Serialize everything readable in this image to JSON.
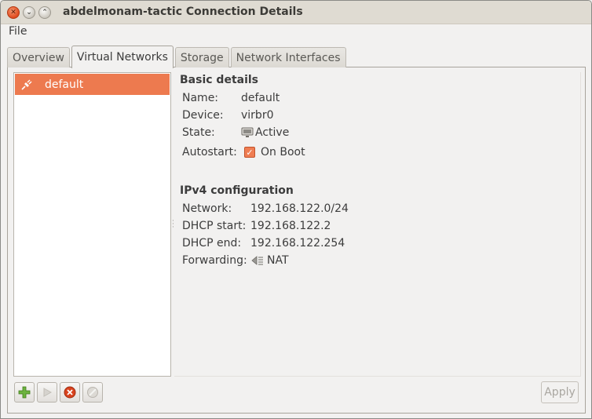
{
  "window": {
    "title": "abdelmonam-tactic Connection Details"
  },
  "menubar": {
    "file_label": "File"
  },
  "tabs": [
    {
      "label": "Overview",
      "active": false
    },
    {
      "label": "Virtual Networks",
      "active": true
    },
    {
      "label": "Storage",
      "active": false
    },
    {
      "label": "Network Interfaces",
      "active": false
    }
  ],
  "networks": [
    {
      "name": "default",
      "selected": true,
      "icon": "plug-icon"
    }
  ],
  "basic_details": {
    "heading": "Basic details",
    "name_label": "Name:",
    "name_value": "default",
    "device_label": "Device:",
    "device_value": "virbr0",
    "state_label": "State:",
    "state_value": "Active",
    "state_icon": "monitor-icon",
    "autostart_label": "Autostart:",
    "autostart_value": "On Boot",
    "autostart_checked": true
  },
  "ipv4": {
    "heading": "IPv4 configuration",
    "network_label": "Network:",
    "network_value": "192.168.122.0/24",
    "dhcp_start_label": "DHCP start:",
    "dhcp_start_value": "192.168.122.2",
    "dhcp_end_label": "DHCP end:",
    "dhcp_end_value": "192.168.122.254",
    "forwarding_label": "Forwarding:",
    "forwarding_value": "NAT",
    "forwarding_icon": "network-nat-icon"
  },
  "toolbar": {
    "add_icon": "add-icon",
    "start_icon": "play-icon",
    "stop_icon": "stop-icon",
    "delete_icon": "delete-icon",
    "apply_label": "Apply"
  },
  "colors": {
    "selection": "#ed7a4f",
    "close_button": "#df4a1e",
    "add_green": "#4e9a06"
  }
}
